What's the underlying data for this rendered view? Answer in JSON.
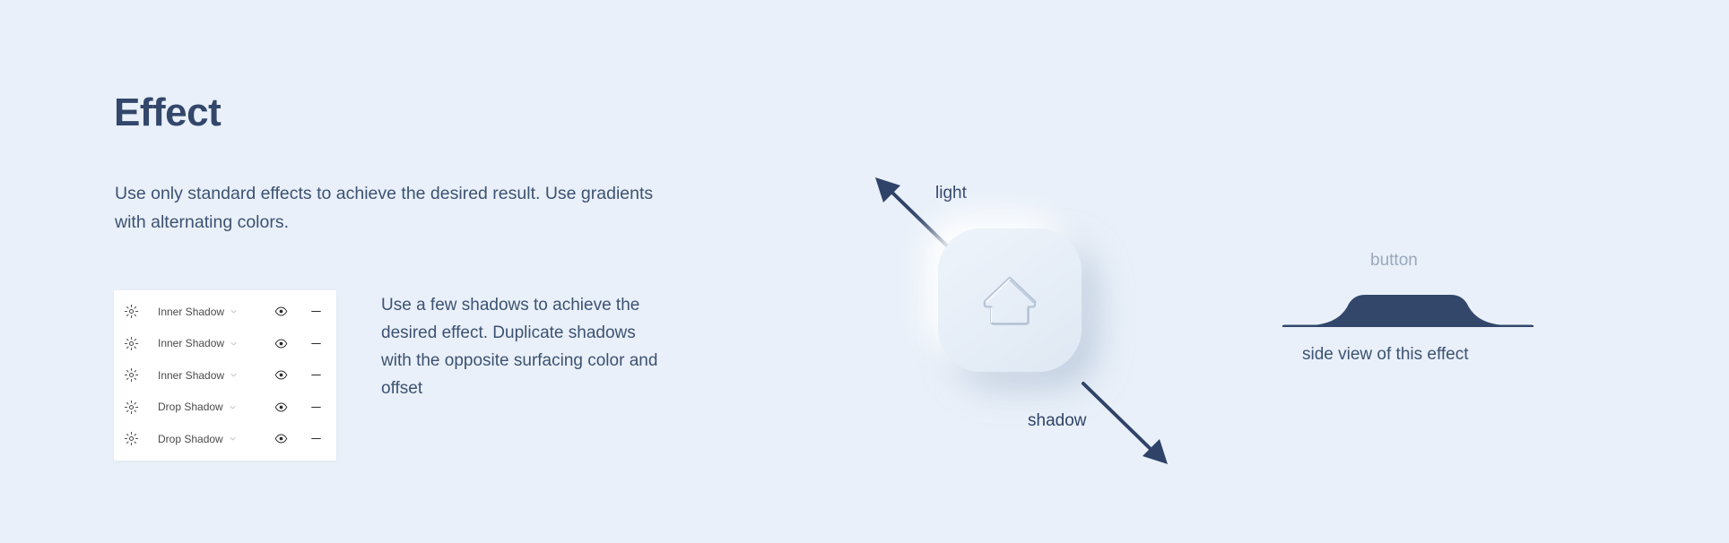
{
  "page": {
    "background_color": "#e9f0f9",
    "title": "Effect",
    "intro": "Use only standard effects to achieve the desired result. Use gradients with alternating colors."
  },
  "colors": {
    "background": "#e9f0f9",
    "heading": "#33476b",
    "body_text": "#3d5272",
    "panel_background": "#ffffff",
    "panel_label": "#4b4b4b",
    "arrow": "#2f4368",
    "plateau": "#33476b",
    "muted_label": "#9aa8bd",
    "button_face_light": "#eef4fb",
    "button_face_dark": "#dfe8f3"
  },
  "effects_panel": {
    "name": "effects-list",
    "rows": [
      {
        "icon": "sun-icon",
        "label": "Inner Shadow",
        "chevron": "chevron-down-icon",
        "visibility": "eye-icon",
        "remove": "minus-icon"
      },
      {
        "icon": "sun-icon",
        "label": "Inner Shadow",
        "chevron": "chevron-down-icon",
        "visibility": "eye-icon",
        "remove": "minus-icon"
      },
      {
        "icon": "sun-icon",
        "label": "Inner Shadow",
        "chevron": "chevron-down-icon",
        "visibility": "eye-icon",
        "remove": "minus-icon"
      },
      {
        "icon": "sun-icon",
        "label": "Drop Shadow",
        "chevron": "chevron-down-icon",
        "visibility": "eye-icon",
        "remove": "minus-icon"
      },
      {
        "icon": "sun-icon",
        "label": "Drop Shadow",
        "chevron": "chevron-down-icon",
        "visibility": "eye-icon",
        "remove": "minus-icon"
      }
    ]
  },
  "panel_note": {
    "text": "Use a few shadows to achieve the desired effect. Duplicate shadows with the opposite surfacing color and offset"
  },
  "illustration": {
    "button_icon": "house-icon",
    "light_label": "light",
    "shadow_label": "shadow",
    "light_arrow": "arrow-up-left-icon",
    "shadow_arrow": "arrow-down-right-icon"
  },
  "side_view": {
    "button_label": "button",
    "caption": "side view of this effect",
    "profile_icon": "plateau-profile"
  }
}
